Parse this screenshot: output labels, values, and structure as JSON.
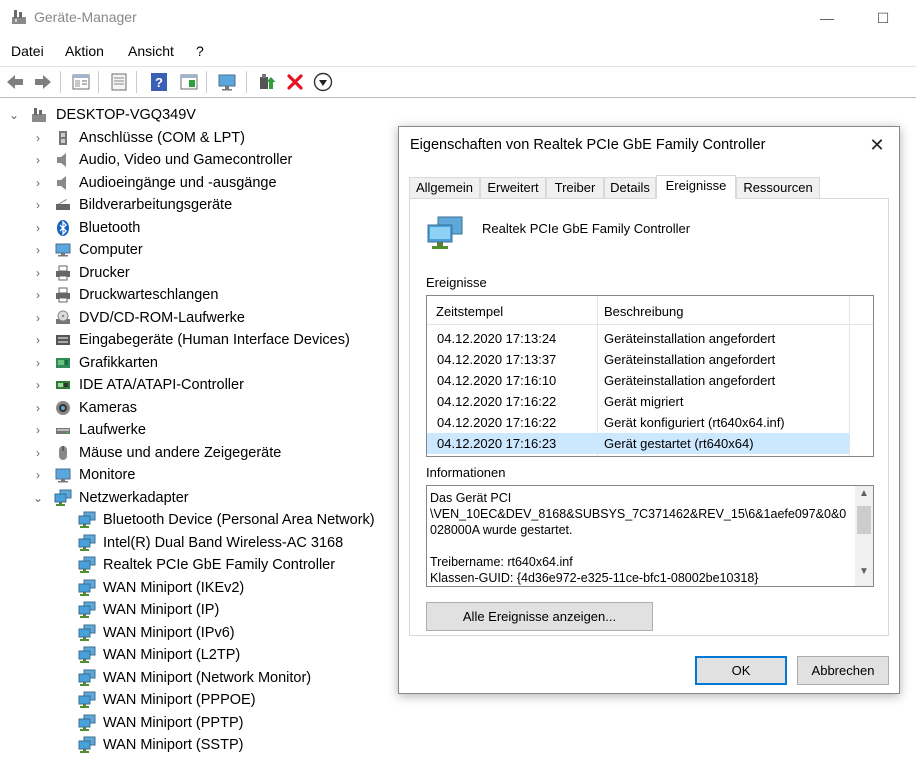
{
  "window": {
    "title": "Geräte-Manager",
    "minimize": "—",
    "maximize": "☐"
  },
  "menu": [
    "Datei",
    "Aktion",
    "Ansicht",
    "?"
  ],
  "toolbar_icons": [
    "back-icon",
    "forward-icon",
    "properties-view-icon",
    "scan-icon",
    "help-icon",
    "console-tree-icon",
    "monitor-icon",
    "update-driver-icon",
    "uninstall-icon",
    "disable-icon"
  ],
  "tree": {
    "root": "DESKTOP-VGQ349V",
    "categories": [
      {
        "label": "Anschlüsse (COM & LPT)",
        "icon": "port-icon"
      },
      {
        "label": "Audio, Video und Gamecontroller",
        "icon": "speaker-icon"
      },
      {
        "label": "Audioeingänge und -ausgänge",
        "icon": "speaker-icon"
      },
      {
        "label": "Bildverarbeitungsgeräte",
        "icon": "scanner-icon"
      },
      {
        "label": "Bluetooth",
        "icon": "bluetooth-icon"
      },
      {
        "label": "Computer",
        "icon": "computer-icon"
      },
      {
        "label": "Drucker",
        "icon": "printer-icon"
      },
      {
        "label": "Druckwarteschlangen",
        "icon": "printer-icon"
      },
      {
        "label": "DVD/CD-ROM-Laufwerke",
        "icon": "dvd-drive-icon"
      },
      {
        "label": "Eingabegeräte (Human Interface Devices)",
        "icon": "hid-icon"
      },
      {
        "label": "Grafikkarten",
        "icon": "display-adapter-icon"
      },
      {
        "label": "IDE ATA/ATAPI-Controller",
        "icon": "ide-controller-icon"
      },
      {
        "label": "Kameras",
        "icon": "camera-icon"
      },
      {
        "label": "Laufwerke",
        "icon": "disk-drive-icon"
      },
      {
        "label": "Mäuse und andere Zeigegeräte",
        "icon": "mouse-icon"
      },
      {
        "label": "Monitore",
        "icon": "monitor-icon"
      },
      {
        "label": "Netzwerkadapter",
        "icon": "network-adapter-icon",
        "expanded": true
      }
    ],
    "network_children": [
      "Bluetooth Device (Personal Area Network)",
      "Intel(R) Dual Band Wireless-AC 3168",
      "Realtek PCIe GbE Family Controller",
      "WAN Miniport (IKEv2)",
      "WAN Miniport (IP)",
      "WAN Miniport (IPv6)",
      "WAN Miniport (L2TP)",
      "WAN Miniport (Network Monitor)",
      "WAN Miniport (PPPOE)",
      "WAN Miniport (PPTP)",
      "WAN Miniport (SSTP)"
    ]
  },
  "dialog": {
    "title": "Eigenschaften von Realtek PCIe GbE Family Controller",
    "close": "✕",
    "tabs": [
      "Allgemein",
      "Erweitert",
      "Treiber",
      "Details",
      "Ereignisse",
      "Ressourcen"
    ],
    "active_tab": "Ereignisse",
    "device_name": "Realtek PCIe GbE Family Controller",
    "events_label": "Ereignisse",
    "events_headers": [
      "Zeitstempel",
      "Beschreibung"
    ],
    "events": [
      {
        "time": "04.12.2020 17:13:24",
        "desc": "Geräteinstallation angefordert"
      },
      {
        "time": "04.12.2020 17:13:37",
        "desc": "Geräteinstallation angefordert"
      },
      {
        "time": "04.12.2020 17:16:10",
        "desc": "Geräteinstallation angefordert"
      },
      {
        "time": "04.12.2020 17:16:22",
        "desc": "Gerät migriert"
      },
      {
        "time": "04.12.2020 17:16:22",
        "desc": "Gerät konfiguriert (rt640x64.inf)"
      },
      {
        "time": "04.12.2020 17:16:23",
        "desc": "Gerät gestartet (rt640x64)",
        "selected": true
      }
    ],
    "info_label": "Informationen",
    "info_text": "Das Gerät PCI\n\\VEN_10EC&DEV_8168&SUBSYS_7C371462&REV_15\\6&1aefe097&0&0028000A wurde gestartet.\n\nTreibername: rt640x64.inf\nKlassen-GUID: {4d36e972-e325-11ce-bfc1-08002be10318}",
    "show_all_button": "Alle Ereignisse anzeigen...",
    "ok_button": "OK",
    "cancel_button": "Abbrechen"
  },
  "colors": {
    "selection": "#cce8ff",
    "accent": "#0078d7",
    "button_face": "#e1e1e1",
    "uninstall_red": "#e81123",
    "update_green": "#2e9e3e"
  }
}
